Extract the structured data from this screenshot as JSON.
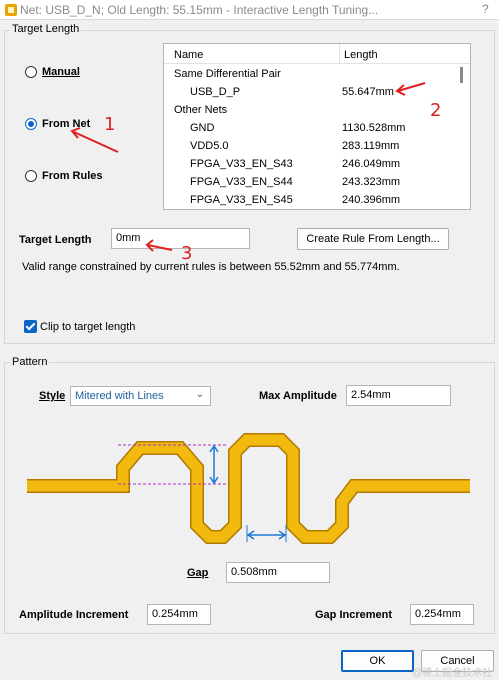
{
  "window": {
    "title": "Net: USB_D_N;  Old Length: 55.15mm  -  Interactive Length Tuning...",
    "help_glyph": "?"
  },
  "target_length_group": {
    "label": "Target Length",
    "radios": [
      {
        "label": "Manual",
        "checked": false
      },
      {
        "label": "From Net",
        "checked": true
      },
      {
        "label": "From Rules",
        "checked": false
      }
    ],
    "net_list": {
      "col_name": "Name",
      "col_length": "Length",
      "rows": [
        {
          "name": "Same Differential Pair",
          "length": "",
          "indent": false
        },
        {
          "name": "USB_D_P",
          "length": "55.647mm",
          "indent": true
        },
        {
          "name": "Other Nets",
          "length": "",
          "indent": false
        },
        {
          "name": "GND",
          "length": "1130.528mm",
          "indent": true
        },
        {
          "name": "VDD5.0",
          "length": "283.119mm",
          "indent": true
        },
        {
          "name": "FPGA_V33_EN_S43",
          "length": "246.049mm",
          "indent": true
        },
        {
          "name": "FPGA_V33_EN_S44",
          "length": "243.323mm",
          "indent": true
        },
        {
          "name": "FPGA_V33_EN_S45",
          "length": "240.396mm",
          "indent": true
        }
      ]
    },
    "target_length_label": "Target Length",
    "target_length_value": "0mm",
    "create_rule_button": "Create Rule From Length...",
    "valid_range_text": "Valid range constrained by current rules is between 55.52mm and 55.774mm.",
    "clip_checkbox_label": "Clip to target length",
    "clip_checked": true
  },
  "pattern_group": {
    "label": "Pattern",
    "style_label": "Style",
    "style_value": "Mitered with Lines",
    "max_amplitude_label": "Max Amplitude",
    "max_amplitude_value": "2.54mm",
    "gap_label": "Gap",
    "gap_value": "0.508mm",
    "amplitude_increment_label": "Amplitude Increment",
    "amplitude_increment_value": "0.254mm",
    "gap_increment_label": "Gap Increment",
    "gap_increment_value": "0.254mm",
    "trace_color": "#f2b90f",
    "trace_outline_color": "#b07a00",
    "dim_color": "#1e78d8",
    "guide_color": "#b030c0"
  },
  "footer": {
    "ok_button": "OK",
    "cancel_button": "Cancel",
    "watermark": "@稀土掘金技术社区"
  },
  "annotations": {
    "color": "#e02020",
    "n1": "1",
    "n2": "2",
    "n3": "3"
  }
}
